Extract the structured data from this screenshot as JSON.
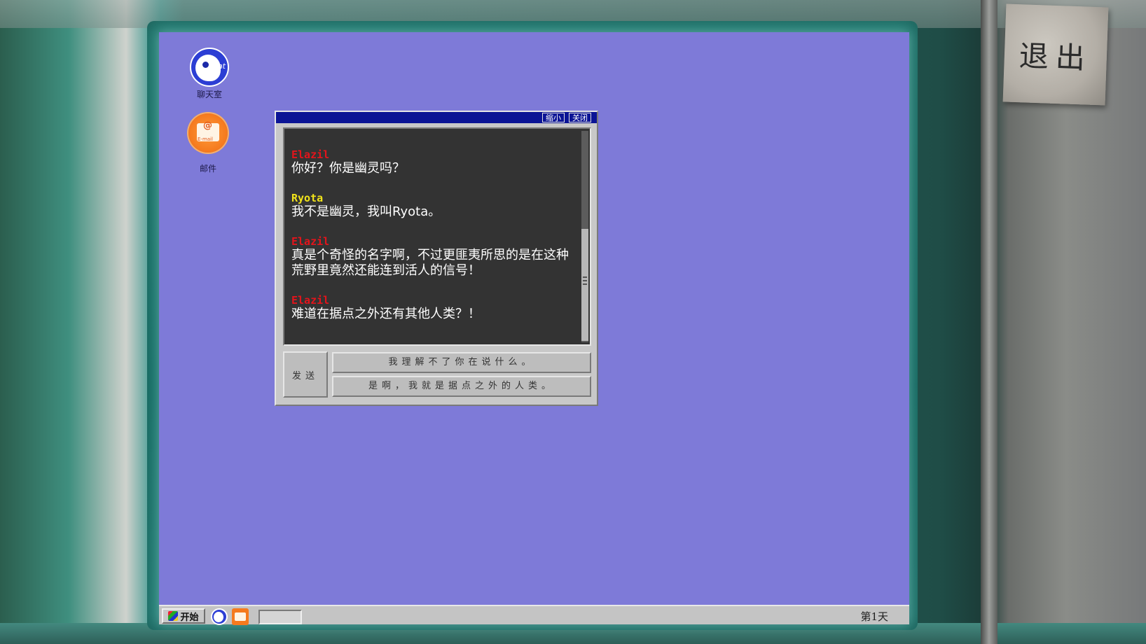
{
  "exit": {
    "label": "退出"
  },
  "desktop": {
    "icons": [
      {
        "name": "chat",
        "label": "聊天室",
        "icon_text": "chat"
      },
      {
        "name": "mail",
        "label": "邮件",
        "icon_text": "E-mail"
      }
    ]
  },
  "chat_window": {
    "minimize_label": "缩小",
    "close_label": "关闭",
    "messages": [
      {
        "sender": "Elazil",
        "text": "你好？你是幽灵吗？"
      },
      {
        "sender": "Ryota",
        "text": "我不是幽灵，我叫Ryota。"
      },
      {
        "sender": "Elazil",
        "text": "真是个奇怪的名字啊，不过更匪夷所思的是在这种荒野里竟然还能连到活人的信号！"
      },
      {
        "sender": "Elazil",
        "text": "难道在据点之外还有其他人类？！"
      }
    ],
    "send_label": "发送",
    "options": [
      "我理解不了你在说什么。",
      "是啊，我就是据点之外的人类。"
    ]
  },
  "taskbar": {
    "start_label": "开始",
    "day_label": "第1天"
  },
  "colors": {
    "desktop": "#7e7ad8",
    "titlebar": "#0b1495",
    "sender_elazil": "#e3141b",
    "sender_ryota": "#f2e41a",
    "chat_bg": "#333333"
  }
}
